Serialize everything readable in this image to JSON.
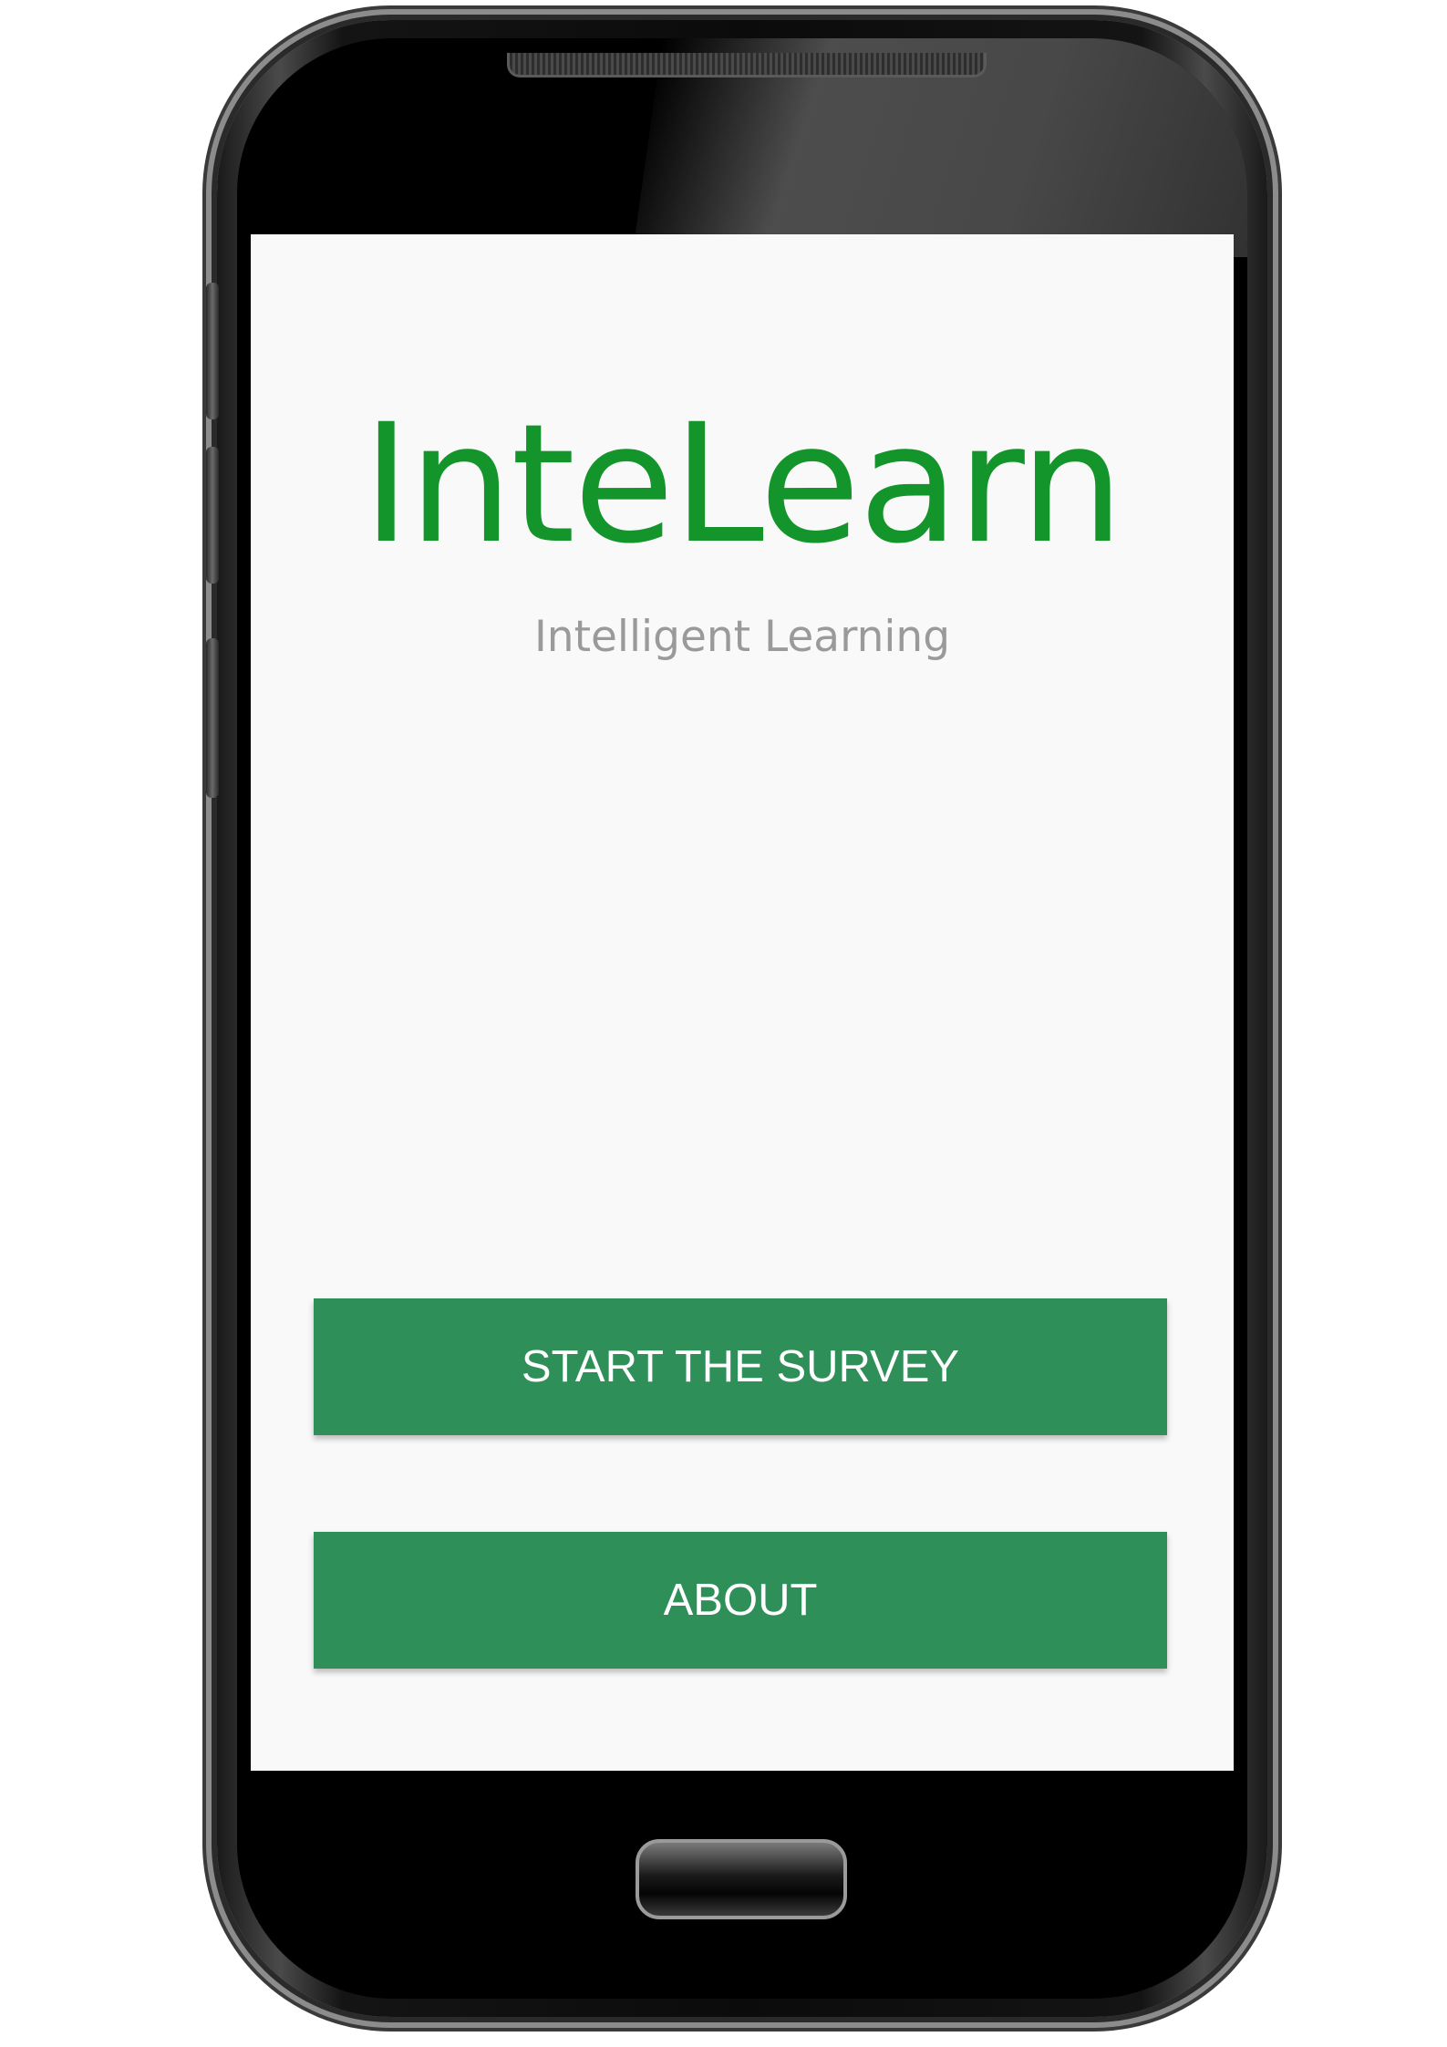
{
  "app": {
    "title": "InteLearn",
    "subtitle": "Intelligent Learning"
  },
  "actions": {
    "start_survey_label": "START THE SURVEY",
    "about_label": "ABOUT"
  },
  "colors": {
    "title_green": "#14952b",
    "button_green": "#2e8f59",
    "subtitle_gray": "#9a9a9a",
    "screen_background": "#f9f9f9"
  }
}
